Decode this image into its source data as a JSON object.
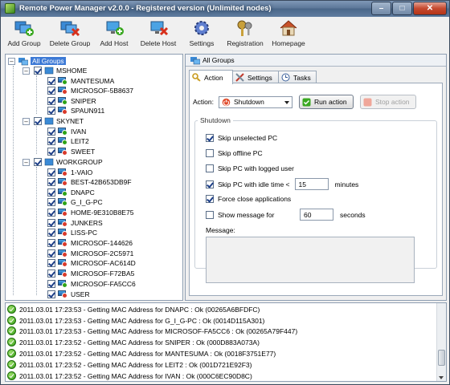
{
  "window": {
    "title": "Remote Power Manager v2.0.0 - Registered version (Unlimited nodes)"
  },
  "toolbar": [
    {
      "label": "Add Group",
      "icon": "add-group-icon"
    },
    {
      "label": "Delete Group",
      "icon": "delete-group-icon"
    },
    {
      "label": "Add Host",
      "icon": "add-host-icon"
    },
    {
      "label": "Delete Host",
      "icon": "delete-host-icon"
    },
    {
      "label": "Settings",
      "icon": "gear-icon"
    },
    {
      "label": "Registration",
      "icon": "keys-icon"
    },
    {
      "label": "Homepage",
      "icon": "house-icon"
    }
  ],
  "tree": {
    "root": "All Groups",
    "groups": [
      {
        "name": "MSHOME",
        "hosts": [
          {
            "name": "MANTESUMA",
            "status": "on"
          },
          {
            "name": "MICROSOF-5B8637",
            "status": "off"
          },
          {
            "name": "SNIPER",
            "status": "on"
          },
          {
            "name": "SPAUN911",
            "status": "off"
          }
        ]
      },
      {
        "name": "SKYNET",
        "hosts": [
          {
            "name": "IVAN",
            "status": "on"
          },
          {
            "name": "LEIT2",
            "status": "on"
          },
          {
            "name": "SWEET",
            "status": "off"
          }
        ]
      },
      {
        "name": "WORKGROUP",
        "hosts": [
          {
            "name": "1-VAIO",
            "status": "off"
          },
          {
            "name": "BEST-42B653DB9F",
            "status": "off"
          },
          {
            "name": "DNAPC",
            "status": "on"
          },
          {
            "name": "G_I_G-PC",
            "status": "on"
          },
          {
            "name": "HOME-9E310B8E75",
            "status": "off"
          },
          {
            "name": "JUNKERS",
            "status": "off"
          },
          {
            "name": "LISS-PC",
            "status": "off"
          },
          {
            "name": "MICROSOF-144626",
            "status": "off"
          },
          {
            "name": "MICROSOF-2C5971",
            "status": "off"
          },
          {
            "name": "MICROSOF-AC614D",
            "status": "off"
          },
          {
            "name": "MICROSOF-F72BA5",
            "status": "off"
          },
          {
            "name": "MICROSOF-FA5CC6",
            "status": "on"
          },
          {
            "name": "USER",
            "status": "off"
          }
        ]
      }
    ]
  },
  "right": {
    "header": "All Groups",
    "tabs": [
      "Action",
      "Settings",
      "Tasks"
    ],
    "action_label": "Action:",
    "action_value": "Shutdown",
    "run_label": "Run action",
    "stop_label": "Stop action",
    "group_title": "Shutdown",
    "options": {
      "skip_unselected": {
        "label": "Skip unselected PC",
        "checked": true
      },
      "skip_offline": {
        "label": "Skip offline PC",
        "checked": false
      },
      "skip_logged": {
        "label": "Skip PC with logged user",
        "checked": false
      },
      "skip_idle": {
        "label": "Skip PC with idle time <",
        "checked": true,
        "value": "15",
        "unit": "minutes"
      },
      "force_close": {
        "label": "Force close applications",
        "checked": true
      },
      "show_message": {
        "label": "Show message for",
        "checked": false,
        "value": "60",
        "unit": "seconds"
      }
    },
    "message_label": "Message:"
  },
  "log": [
    "2011.03.01 17:23:53 - Getting MAC Address for DNAPC : Ok (00265A6BFDFC)",
    "2011.03.01 17:23:53 - Getting MAC Address for G_I_G-PC : Ok (0014D115A301)",
    "2011.03.01 17:23:53 - Getting MAC Address for MICROSOF-FA5CC6 : Ok (00265A79F447)",
    "2011.03.01 17:23:52 - Getting MAC Address for SNIPER : Ok (000D883A073A)",
    "2011.03.01 17:23:52 - Getting MAC Address for MANTESUMA : Ok (0018F3751E77)",
    "2011.03.01 17:23:52 - Getting MAC Address for LEIT2 : Ok (001D721E92F3)",
    "2011.03.01 17:23:52 - Getting MAC Address for IVAN : Ok (000C6EC90D8C)"
  ],
  "colors": {
    "online": "#2ea317",
    "offline": "#d93a2b",
    "accent": "#1a5ea8"
  }
}
